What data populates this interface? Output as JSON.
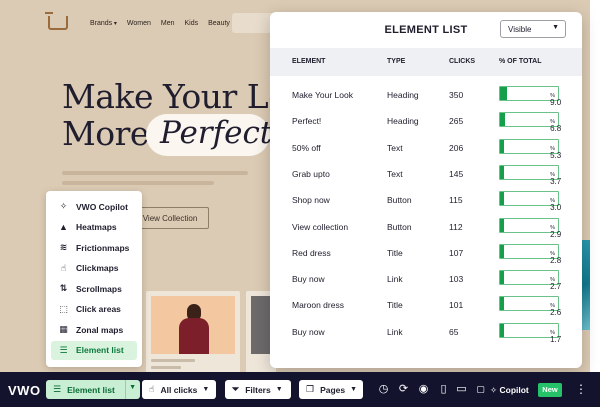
{
  "site": {
    "nav": [
      "Brands",
      "Women",
      "Men",
      "Kids",
      "Beauty"
    ],
    "hero_line1": "Make Your Lo",
    "hero_line2": "More",
    "hero_perfect": "Perfect!",
    "view_collection": "View Collection"
  },
  "tool_menu": {
    "items": [
      {
        "label": "VWO Copilot",
        "icon": "sparkle-icon",
        "glyph": "✧"
      },
      {
        "label": "Heatmaps",
        "icon": "flame-icon",
        "glyph": "▲"
      },
      {
        "label": "Frictionmaps",
        "icon": "friction-icon",
        "glyph": "≋"
      },
      {
        "label": "Clickmaps",
        "icon": "pointer-icon",
        "glyph": "☝"
      },
      {
        "label": "Scrollmaps",
        "icon": "scroll-icon",
        "glyph": "⇅"
      },
      {
        "label": "Click areas",
        "icon": "dashed-square-icon",
        "glyph": "⬚"
      },
      {
        "label": "Zonal maps",
        "icon": "grid-icon",
        "glyph": "▦"
      },
      {
        "label": "Element list",
        "icon": "list-icon",
        "glyph": "☰"
      }
    ],
    "active_index": 7
  },
  "panel": {
    "title": "ELEMENT LIST",
    "filter_value": "Visible",
    "columns": {
      "element": "ELEMENT",
      "type": "TYPE",
      "clicks": "CLICKS",
      "pct": "% OF TOTAL"
    },
    "rows": [
      {
        "element": "Make Your Look",
        "type": "Heading",
        "clicks": "350",
        "pct": 9.0
      },
      {
        "element": "Perfect!",
        "type": "Heading",
        "clicks": "265",
        "pct": 6.8
      },
      {
        "element": "50% off",
        "type": "Text",
        "clicks": "206",
        "pct": 5.3
      },
      {
        "element": "Grab upto",
        "type": "Text",
        "clicks": "145",
        "pct": 3.7
      },
      {
        "element": "Shop now",
        "type": "Button",
        "clicks": "115",
        "pct": 3.0
      },
      {
        "element": "View collection",
        "type": "Button",
        "clicks": "112",
        "pct": 2.9
      },
      {
        "element": "Red dress",
        "type": "Title",
        "clicks": "107",
        "pct": 2.8
      },
      {
        "element": "Buy now",
        "type": "Link",
        "clicks": "103",
        "pct": 2.7
      },
      {
        "element": "Maroon dress",
        "type": "Title",
        "clicks": "101",
        "pct": 2.6
      },
      {
        "element": "Buy now",
        "type": "Link",
        "clicks": "65",
        "pct": 1.7
      }
    ]
  },
  "toolbar": {
    "logo": "VWO",
    "element_list_label": "Element list",
    "all_clicks_label": "All clicks",
    "filters_label": "Filters",
    "pages_label": "Pages",
    "copilot_label": "Copilot",
    "new_badge": "New",
    "icons": [
      "gauge-icon",
      "refresh-icon",
      "eye-icon",
      "mobile-icon",
      "tablet-icon",
      "desktop-icon"
    ]
  },
  "colors": {
    "accent_green": "#159f4a",
    "toolbar_bg": "#13132e",
    "site_bg": "#dccbb4"
  }
}
